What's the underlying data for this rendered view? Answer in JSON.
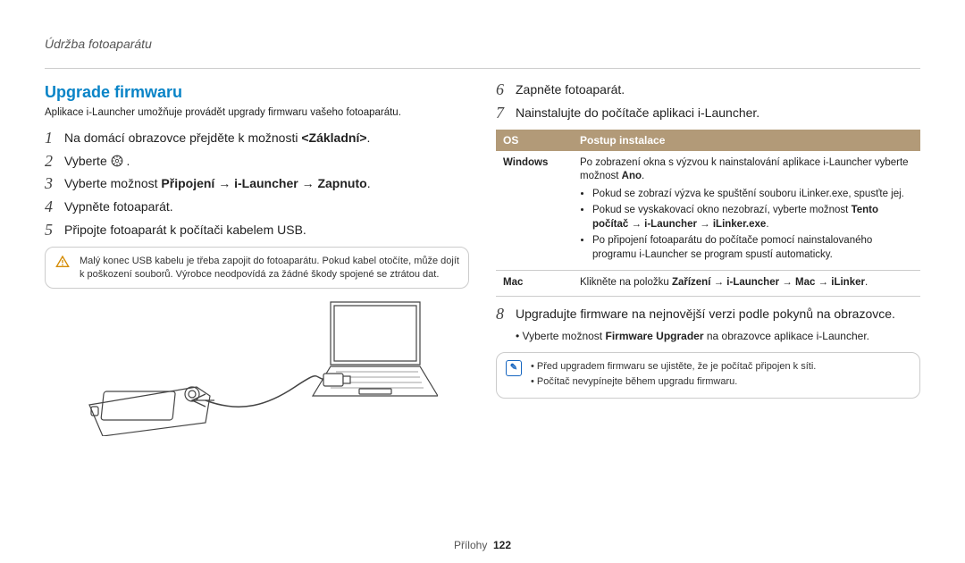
{
  "header": "Údržba fotoaparátu",
  "section_title": "Upgrade firmwaru",
  "intro": "Aplikace i-Launcher umožňuje provádět upgrady firmwaru vašeho fotoaparátu.",
  "steps_left": [
    {
      "n": "1",
      "html": "Na domácí obrazovce přejděte k možnosti <b class='inline'>&lt;Základní&gt;</b>."
    },
    {
      "n": "2",
      "html": "Vyberte <span class='gear-icon' data-name='settings-gear-icon' data-interactable='false'><svg viewBox='0 0 24 24'><circle cx='12' cy='12' r='10' fill='none' stroke='#333' stroke-width='1.8'/><circle cx='12' cy='12' r='3' fill='none' stroke='#333' stroke-width='1.5'/><g stroke='#333' stroke-width='1.5'><line x1='12' y1='2' x2='12' y2='6'/><line x1='12' y1='18' x2='12' y2='22'/><line x1='2' y1='12' x2='6' y2='12'/><line x1='18' y1='12' x2='22' y2='12'/><line x1='5' y1='5' x2='8' y2='8'/><line x1='16' y1='16' x2='19' y2='19'/><line x1='19' y1='5' x2='16' y2='8'/><line x1='8' y1='16' x2='5' y2='19'/></g></svg></span> ."
    },
    {
      "n": "3",
      "html": "Vyberte možnost <b class='inline'>Připojení</b> → <b class='inline'>i-Launcher</b> → <b class='inline'>Zapnuto</b>."
    },
    {
      "n": "4",
      "html": "Vypněte fotoaparát."
    },
    {
      "n": "5",
      "html": "Připojte fotoaparát k počítači kabelem USB."
    }
  ],
  "warning": "Malý konec USB kabelu je třeba zapojit do fotoaparátu. Pokud kabel otočíte, může dojít k poškození souborů. Výrobce neodpovídá za žádné škody spojené se ztrátou dat.",
  "steps_right": [
    {
      "n": "6",
      "html": "Zapněte fotoaparát."
    },
    {
      "n": "7",
      "html": "Nainstalujte do počítače aplikaci i-Launcher."
    },
    {
      "n": "8",
      "html": "Upgradujte firmware na nejnovější verzi podle pokynů na obrazovce."
    }
  ],
  "table": {
    "headers": [
      "OS",
      "Postup instalace"
    ],
    "rows": [
      {
        "os": "Windows",
        "lead": "Po zobrazení okna s výzvou k nainstalování aplikace i-Launcher vyberte možnost <b class='inline'>Ano</b>.",
        "bullets": [
          "Pokud se zobrazí výzva ke spuštění souboru iLinker.exe, spusťte jej.",
          "Pokud se vyskakovací okno nezobrazí, vyberte možnost <b class='inline'>Tento počítač</b> → <b class='inline'>i-Launcher</b> → <b class='inline'>iLinker.exe</b>.",
          "Po připojení fotoaparátu do počítače pomocí nainstalovaného programu i-Launcher se program spustí automaticky."
        ]
      },
      {
        "os": "Mac",
        "lead": "Klikněte na položku <b class='inline'>Zařízení</b> → <b class='inline'>i-Launcher</b> → <b class='inline'>Mac</b> → <b class='inline'>iLinker</b>.",
        "bullets": []
      }
    ]
  },
  "step8_sub": "Vyberte možnost <b class='inline'>Firmware Upgrader</b> na obrazovce aplikace i-Launcher.",
  "info_bullets": [
    "Před upgradem firmwaru se ujistěte, že je počítač připojen k síti.",
    "Počítač nevypínejte během upgradu firmwaru."
  ],
  "footer_label": "Přílohy",
  "footer_page": "122"
}
